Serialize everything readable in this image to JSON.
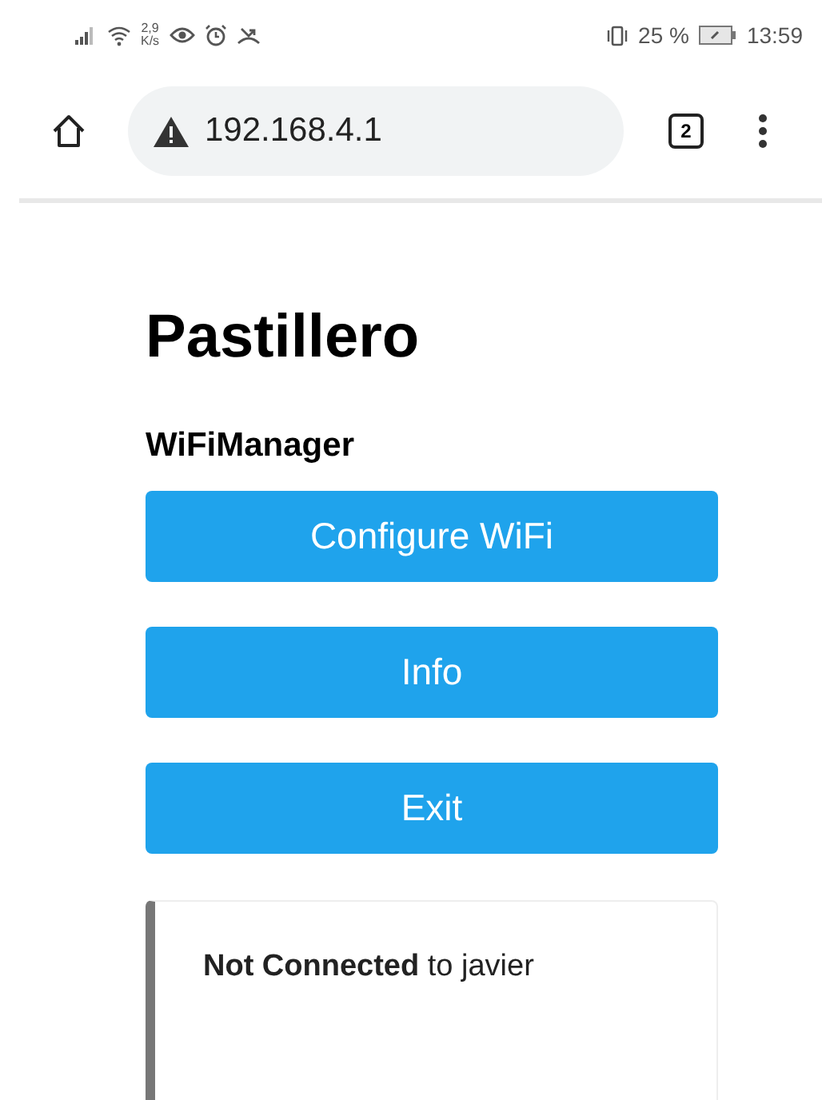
{
  "status_bar": {
    "net_speed_value": "2,9",
    "net_speed_unit": "K/s",
    "battery_percent": "25 %",
    "time": "13:59"
  },
  "browser_bar": {
    "url": "192.168.4.1",
    "tab_count": "2"
  },
  "page": {
    "title": "Pastillero",
    "subtitle": "WiFiManager",
    "buttons": [
      {
        "label": "Configure WiFi"
      },
      {
        "label": "Info"
      },
      {
        "label": "Exit"
      }
    ],
    "status_message": "**Not Connected** to javier"
  }
}
